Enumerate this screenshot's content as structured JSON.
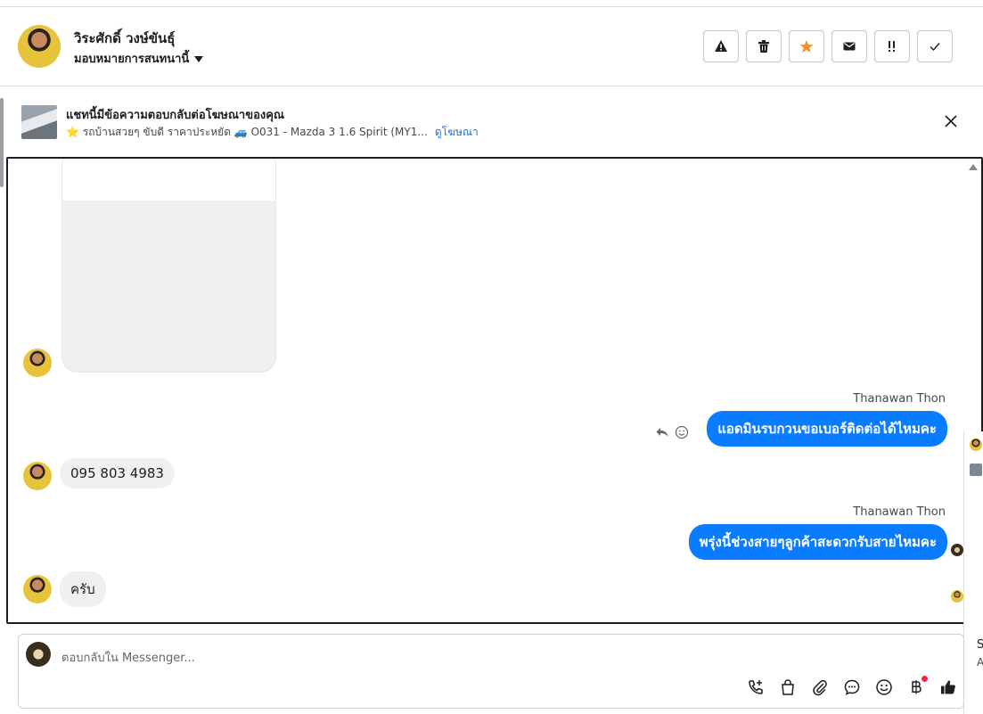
{
  "header": {
    "contact_name": "วิระศักดิ์ วงษ์ขันธุ์",
    "assign_label": "มอบหมายการสนทนานี้",
    "actions": [
      {
        "name": "alert-icon",
        "label": "!"
      },
      {
        "name": "trash-icon",
        "label": ""
      },
      {
        "name": "star-icon",
        "label": ""
      },
      {
        "name": "mail-icon",
        "label": ""
      },
      {
        "name": "important-icon",
        "label": "!!"
      },
      {
        "name": "check-icon",
        "label": ""
      }
    ],
    "colors": {
      "star": "#f0932b"
    }
  },
  "ad": {
    "title": "แชทนี้มีข้อความตอบกลับต่อโฆษณาของคุณ",
    "subtitle": "⭐ รถบ้านสวยๆ ขับดี ราคาประหยัด 🚙 O031 - Mazda 3 1.6 Spirit (MY1...",
    "link": "ดูโฆษณา"
  },
  "messages": [
    {
      "direction": "out",
      "sender": "Thanawan Thon",
      "text": "แอดมินรบกวนขอเบอร์ติดต่อได้ไหมคะ"
    },
    {
      "direction": "in",
      "text": "095 803 4983"
    },
    {
      "direction": "out",
      "sender": "Thanawan Thon",
      "text": "พรุ่งนี้ช่วงสายๆลูกค้าสะดวกรับสายไหมคะ"
    },
    {
      "direction": "in",
      "text": "ครับ"
    }
  ],
  "composer": {
    "placeholder": "ตอบกลับใน Messenger..."
  },
  "peek": {
    "line1": "S",
    "line2": "A"
  },
  "colors": {
    "outgoing_bubble": "#0a7cff",
    "incoming_bubble": "#f0f0f0",
    "link": "#216fdb"
  }
}
